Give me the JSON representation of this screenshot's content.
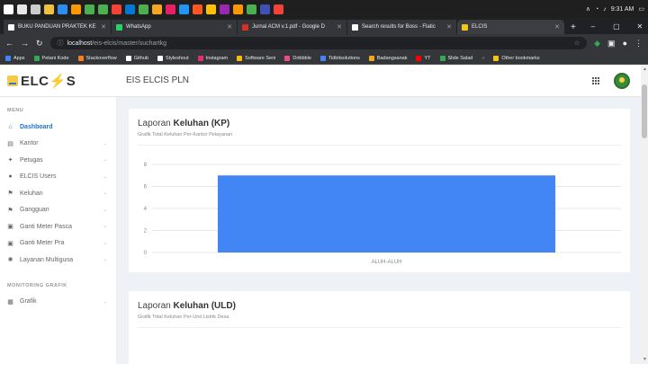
{
  "taskbar": {
    "icons": [
      "#ffffff",
      "#e6e6e6",
      "#cccccc",
      "#f0c040",
      "#2d8cf0",
      "#ff9800",
      "#4caf50",
      "#4caf50",
      "#f44336",
      "#0078d4",
      "#4caf50",
      "#f5a623",
      "#e91e63",
      "#2196f3",
      "#ff5722",
      "#ffc107",
      "#9c27b0",
      "#ff9800",
      "#4caf50",
      "#3f51b5",
      "#f44336"
    ],
    "time": "9:31 AM"
  },
  "tabs": [
    {
      "label": "BUKU PANDUAN PRAKTEK KE",
      "color": "#ffffff"
    },
    {
      "label": "WhatsApp",
      "color": "#25d366"
    },
    {
      "label": "Jurnal ACM v.1.pdf - Google D",
      "color": "#d93025"
    },
    {
      "label": "Search results for Boss - Flatic",
      "color": "#ffffff"
    },
    {
      "label": "ELCIS",
      "color": "#f5c518",
      "active": true
    }
  ],
  "address": {
    "host": "localhost",
    "path": "/eis-elcis/master/suchartkg"
  },
  "bookmarks": [
    {
      "label": "Apps",
      "color": "#4285f4"
    },
    {
      "label": "Petani Kode",
      "color": "#34a853"
    },
    {
      "label": "Stackoverflow",
      "color": "#f48024"
    },
    {
      "label": "Github",
      "color": "#ffffff"
    },
    {
      "label": "Styleshout",
      "color": "#ffffff"
    },
    {
      "label": "Instagram",
      "color": "#e1306c"
    },
    {
      "label": "Software Seni",
      "color": "#fbbc05"
    },
    {
      "label": "Dribbble",
      "color": "#ea4c89"
    },
    {
      "label": "Tidbitsolutions",
      "color": "#4285f4"
    },
    {
      "label": "Badangsanak",
      "color": "#f5a623"
    },
    {
      "label": "YT",
      "color": "#ff0000"
    },
    {
      "label": "Slide Salad",
      "color": "#34a853"
    }
  ],
  "bookmarks_other": "Other bookmarks",
  "app": {
    "logo_pre": "ELC",
    "logo_bolt": "⚡",
    "logo_post": "S",
    "title": "EIS ELCIS PLN"
  },
  "sidebar": {
    "menu_title": "MENU",
    "items": [
      {
        "label": "Dashboard",
        "icon": "⌂",
        "active": true
      },
      {
        "label": "Kantor",
        "icon": "▤"
      },
      {
        "label": "Petugas",
        "icon": "✦"
      },
      {
        "label": "ELCIS Users",
        "icon": "●"
      },
      {
        "label": "Keluhan",
        "icon": "⚑"
      },
      {
        "label": "Gangguan",
        "icon": "⚑"
      },
      {
        "label": "Ganti Meter Pasca",
        "icon": "▣"
      },
      {
        "label": "Ganti Meter Pra",
        "icon": "▣"
      },
      {
        "label": "Layanan Multiguna",
        "icon": "✺"
      }
    ],
    "monitoring_title": "MONITORING GRAFIK",
    "monitoring_items": [
      {
        "label": "Grafik",
        "icon": "▦"
      }
    ]
  },
  "cards": {
    "kp": {
      "title_pre": "Laporan ",
      "title_bold": "Keluhan (KP)",
      "subtitle": "Grafik Total Keluhan Per-Kantor Pelayanan"
    },
    "uld": {
      "title_pre": "Laporan ",
      "title_bold": "Keluhan (ULD)",
      "subtitle": "Grafik Total Keluhan Per-Unit Listrik Desa"
    }
  },
  "chart_data": {
    "type": "bar",
    "categories": [
      "ALUH-ALUH"
    ],
    "values": [
      7
    ],
    "ylim": [
      0,
      8
    ],
    "yticks": [
      0,
      2,
      4,
      6,
      8
    ],
    "grid": true,
    "bar_color": "#4285f4"
  }
}
